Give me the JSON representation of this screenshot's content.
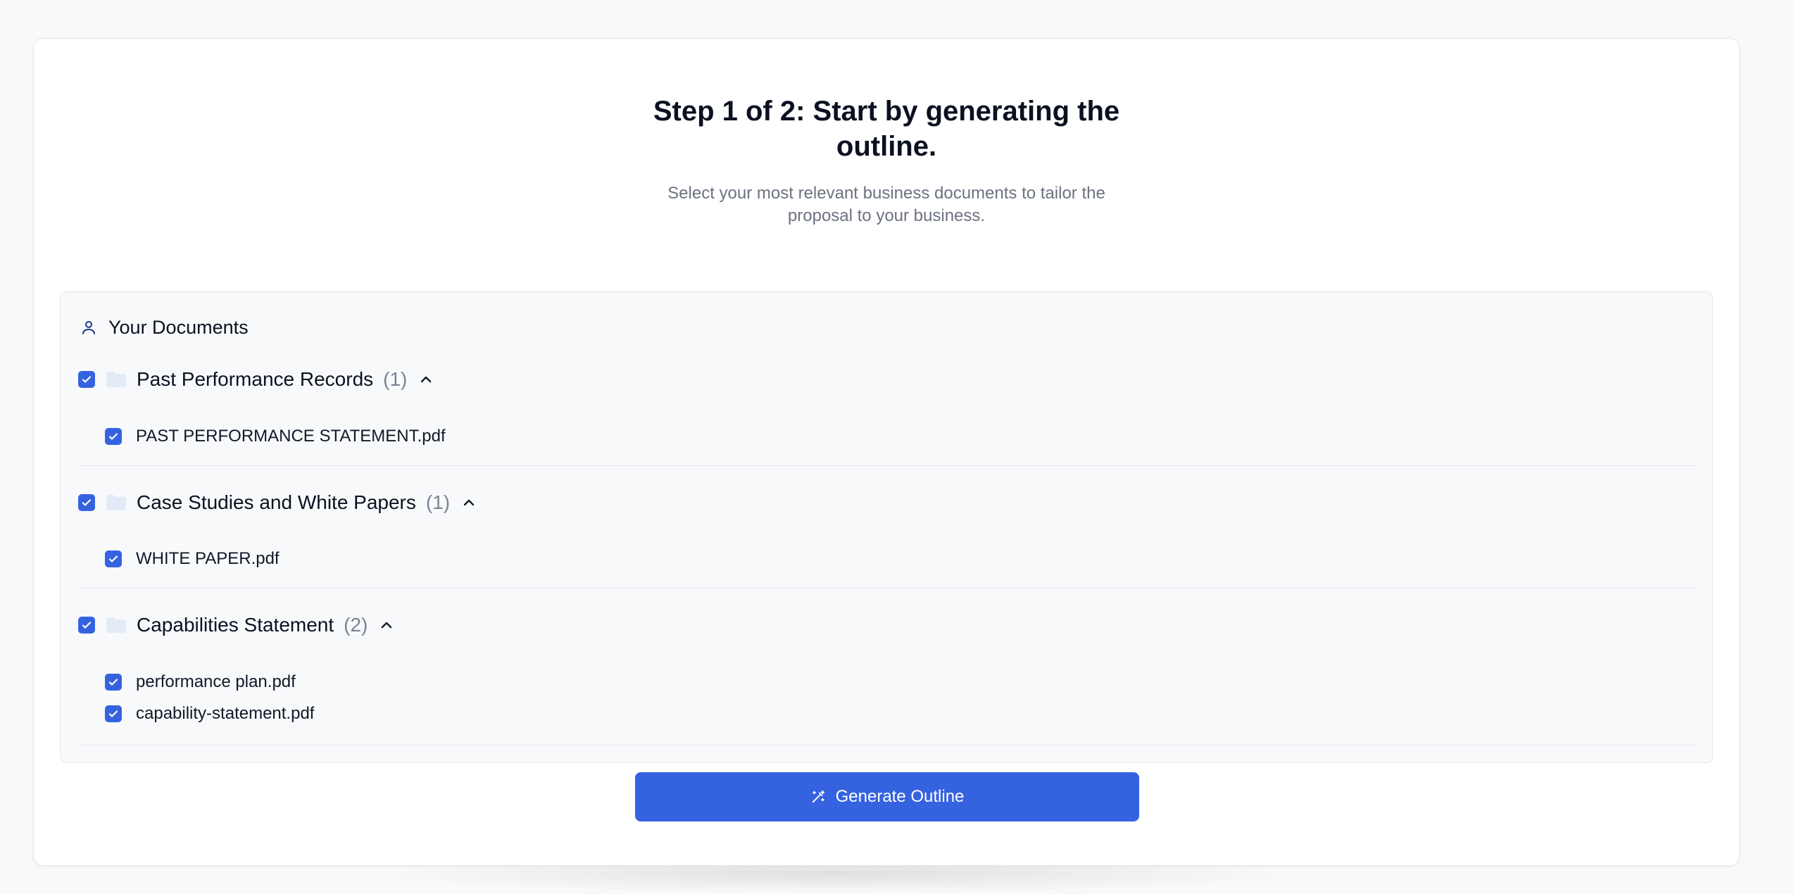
{
  "page": {
    "title": "Step 1 of 2: Start by generating the outline.",
    "subtitle": "Select your most relevant business documents to tailor the proposal to your business."
  },
  "documents": {
    "header_label": "Your Documents",
    "header_icon": "user-icon",
    "groups": [
      {
        "name": "Past Performance Records",
        "count": "(1)",
        "checked": true,
        "expanded": true,
        "files": [
          {
            "name": "PAST PERFORMANCE STATEMENT.pdf",
            "checked": true
          }
        ]
      },
      {
        "name": "Case Studies and White Papers",
        "count": "(1)",
        "checked": true,
        "expanded": true,
        "files": [
          {
            "name": "WHITE PAPER.pdf",
            "checked": true
          }
        ]
      },
      {
        "name": "Capabilities Statement",
        "count": "(2)",
        "checked": true,
        "expanded": true,
        "files": [
          {
            "name": "performance plan.pdf",
            "checked": true
          },
          {
            "name": "capability-statement.pdf",
            "checked": true
          }
        ]
      }
    ]
  },
  "actions": {
    "generate_label": "Generate Outline",
    "generate_icon": "magic-wand-icon"
  },
  "colors": {
    "accent": "#3563e0",
    "folder": "#e3eaf8",
    "muted_text": "#6b7280",
    "background": "#f8f9fb"
  }
}
